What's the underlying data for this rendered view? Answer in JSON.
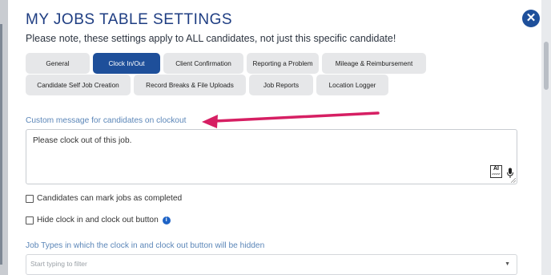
{
  "modal": {
    "title": "MY JOBS TABLE SETTINGS",
    "subtitle": "Please note, these settings apply to ALL candidates, not just this specific candidate!",
    "close_symbol": "✕"
  },
  "tabs": [
    {
      "label": "General",
      "active": false
    },
    {
      "label": "Clock In/Out",
      "active": true
    },
    {
      "label": "Client Confirmation",
      "active": false
    },
    {
      "label": "Reporting a Problem",
      "active": false
    },
    {
      "label": "Mileage & Reimbursement",
      "active": false
    },
    {
      "label": "Candidate Self Job Creation",
      "active": false
    },
    {
      "label": "Record Breaks & File Uploads",
      "active": false
    },
    {
      "label": "Job Reports",
      "active": false
    },
    {
      "label": "Location Logger",
      "active": false
    }
  ],
  "clockout": {
    "label": "Custom message for candidates on clockout",
    "value": "Please clock out of this job.",
    "ai_label": "AI",
    "ai_sub": "ASSIST"
  },
  "options": {
    "mark_completed": "Candidates can mark jobs as completed",
    "hide_clock": "Hide clock in and clock out button",
    "info_symbol": "i"
  },
  "job_types": {
    "label": "Job Types in which the clock in and clock out button will be hidden",
    "placeholder": "Start typing to filter"
  },
  "colors": {
    "accent": "#1e4f9a",
    "label_blue": "#5b86b8",
    "annotation_arrow": "#d61f63"
  }
}
